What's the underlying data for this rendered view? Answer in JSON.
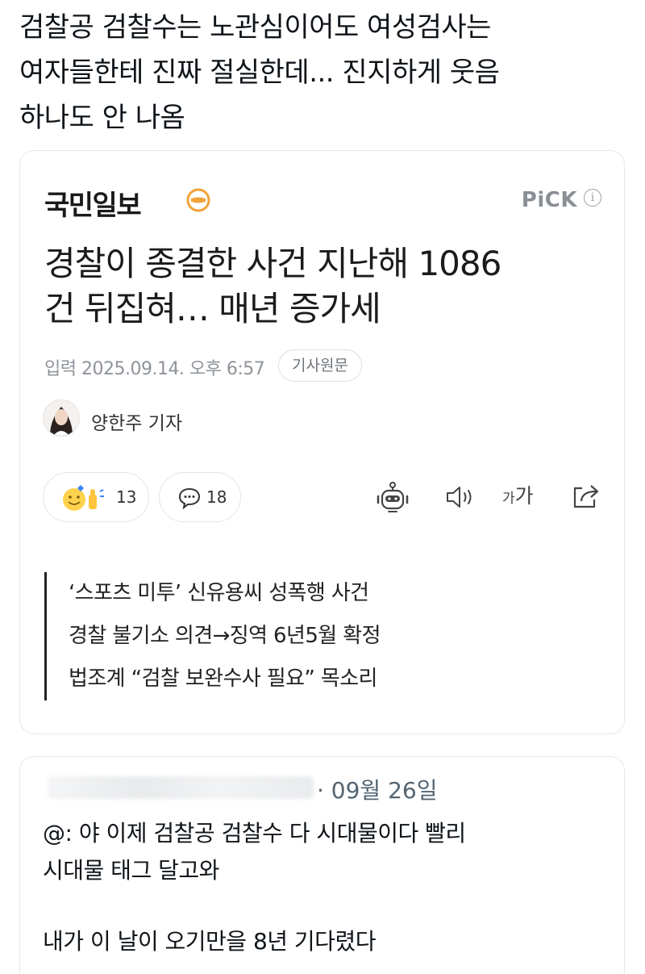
{
  "post": {
    "text_lines": [
      "검찰공 검찰수는 노관심이어도 여성검사는",
      "여자들한테 진짜 절실한데... 진지하게 웃음",
      "하나도 안 나옴"
    ]
  },
  "article": {
    "publisher": "국민일보",
    "badge": "PiCK",
    "info_symbol": "i",
    "headline_lines": [
      "경찰이 종결한 사건 지난해 1086",
      "건 뒤집혀… 매년 증가세"
    ],
    "date": "입력 2025.09.14. 오후 6:57",
    "original_button": "기사원문",
    "reporter": "양한주 기자",
    "reaction_count": "13",
    "comment_count": "18",
    "font_small": "가",
    "font_big": "가",
    "summary_lines": [
      "‘스포츠 미투’ 신유용씨 성폭행 사건",
      "경찰 불기소 의견→징역 6년5월 확정",
      "법조계 “검찰 보완수사 필요” 목소리"
    ],
    "icons": [
      "publisher-logo-icon",
      "info-icon",
      "reaction-emoji-icon",
      "comment-icon",
      "robot-icon",
      "speaker-icon",
      "font-size-icon",
      "share-icon"
    ]
  },
  "reply": {
    "date": "· 09월 26일",
    "line1": "@: 야 이제 검찰공 검찰수 다 시대물이다 빨리",
    "line2": "시대물 태그 달고와",
    "line3": "내가 이 날이 오기만을 8년 기다렸다"
  },
  "colors": {
    "text": "#0f1419",
    "muted": "#8f949a",
    "logo_orange": "#f0a33a",
    "border": "#e6e8eb"
  }
}
